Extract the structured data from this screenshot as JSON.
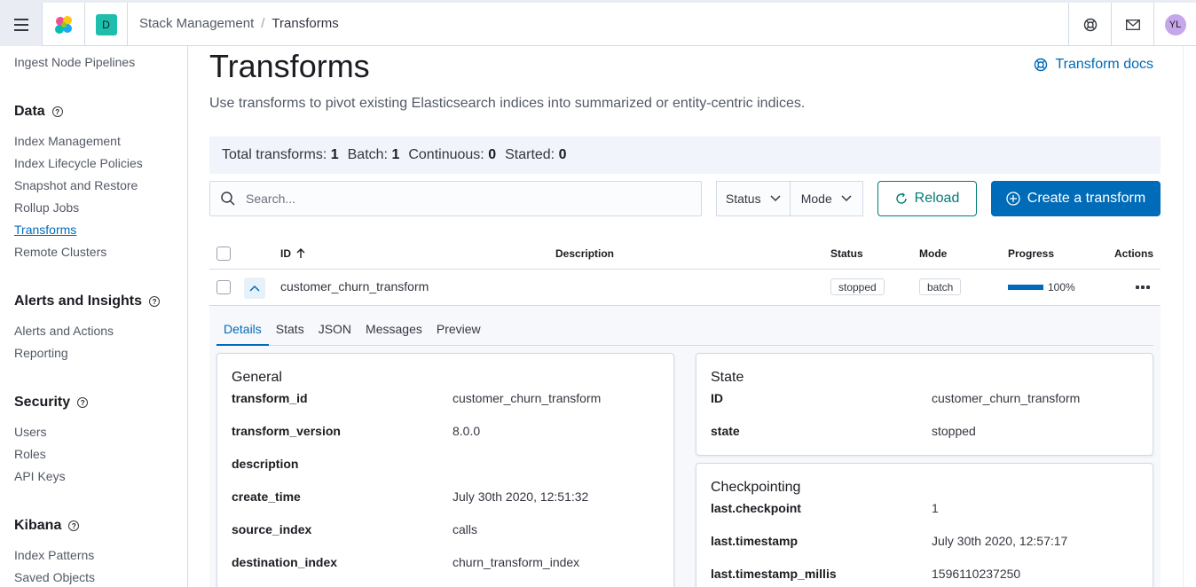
{
  "header": {
    "space_initial": "D",
    "breadcrumbs": [
      "Stack Management",
      "Transforms"
    ],
    "avatar_initials": "YL"
  },
  "sidebar": {
    "top_item": "Ingest Node Pipelines",
    "groups": [
      {
        "title": "Data",
        "items": [
          "Index Management",
          "Index Lifecycle Policies",
          "Snapshot and Restore",
          "Rollup Jobs",
          "Transforms",
          "Remote Clusters"
        ]
      },
      {
        "title": "Alerts and Insights",
        "items": [
          "Alerts and Actions",
          "Reporting"
        ]
      },
      {
        "title": "Security",
        "items": [
          "Users",
          "Roles",
          "API Keys"
        ]
      },
      {
        "title": "Kibana",
        "items": [
          "Index Patterns",
          "Saved Objects"
        ]
      }
    ],
    "active_item": "Transforms"
  },
  "page": {
    "title": "Transforms",
    "docs_link": "Transform docs",
    "subtitle": "Use transforms to pivot existing Elasticsearch indices into summarized or entity-centric indices."
  },
  "stats": {
    "total_label": "Total transforms:",
    "total": "1",
    "batch_label": "Batch:",
    "batch": "1",
    "continuous_label": "Continuous:",
    "continuous": "0",
    "started_label": "Started:",
    "started": "0"
  },
  "toolbar": {
    "search_placeholder": "Search...",
    "status_filter": "Status",
    "mode_filter": "Mode",
    "reload_label": "Reload",
    "create_label": "Create a transform"
  },
  "table": {
    "columns": {
      "id": "ID",
      "description": "Description",
      "status": "Status",
      "mode": "Mode",
      "progress": "Progress",
      "actions": "Actions"
    },
    "rows": [
      {
        "id": "customer_churn_transform",
        "description": "",
        "status": "stopped",
        "mode": "batch",
        "progress": 1.0,
        "progress_label": "100%"
      }
    ]
  },
  "details": {
    "tabs": [
      "Details",
      "Stats",
      "JSON",
      "Messages",
      "Preview"
    ],
    "active_tab": "Details",
    "general": {
      "title": "General",
      "rows": [
        {
          "key": "transform_id",
          "value": "customer_churn_transform"
        },
        {
          "key": "transform_version",
          "value": "8.0.0"
        },
        {
          "key": "description",
          "value": ""
        },
        {
          "key": "create_time",
          "value": "July 30th 2020, 12:51:32"
        },
        {
          "key": "source_index",
          "value": "calls"
        },
        {
          "key": "destination_index",
          "value": "churn_transform_index"
        }
      ]
    },
    "state": {
      "title": "State",
      "rows": [
        {
          "key": "ID",
          "value": "customer_churn_transform"
        },
        {
          "key": "state",
          "value": "stopped"
        }
      ]
    },
    "checkpointing": {
      "title": "Checkpointing",
      "rows": [
        {
          "key": "last.checkpoint",
          "value": "1"
        },
        {
          "key": "last.timestamp",
          "value": "July 30th 2020, 12:57:17"
        },
        {
          "key": "last.timestamp_millis",
          "value": "1596110237250"
        }
      ]
    }
  },
  "colors": {
    "primary": "#006bb8",
    "secondary": "#017d73",
    "space_badge": "#1ebeac"
  }
}
